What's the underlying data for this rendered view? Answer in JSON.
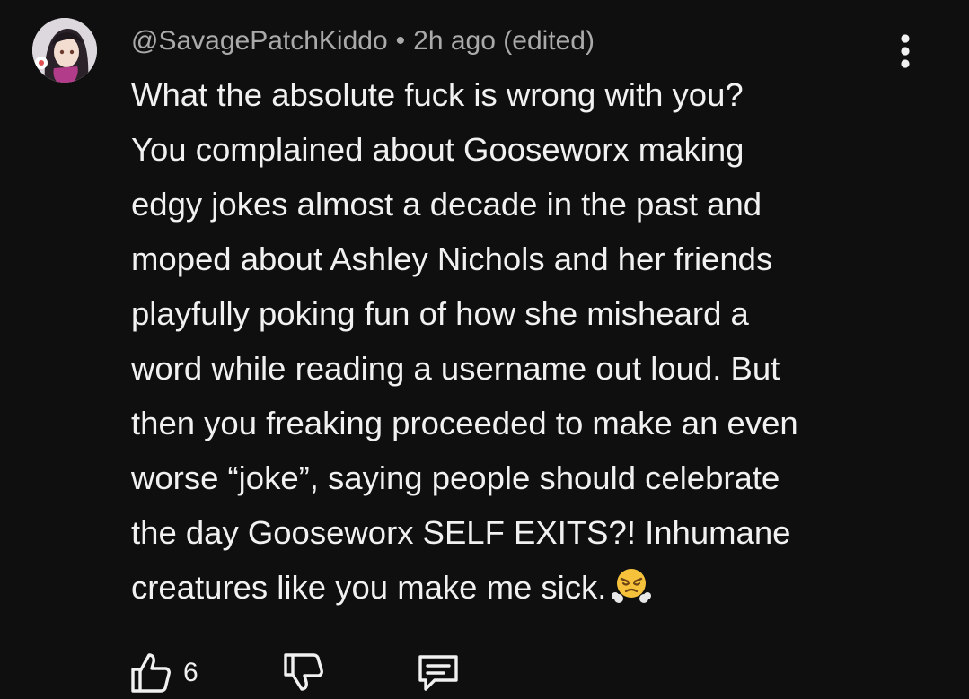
{
  "comment": {
    "author": "@SavagePatchKiddo",
    "separator": "•",
    "time": "2h ago (edited)",
    "lines": [
      "What the absolute fuck is wrong with you?",
      "You complained about Gooseworx making",
      "edgy jokes almost a decade in the past and",
      "moped about Ashley Nichols and her friends",
      "playfully poking fun of how she misheard a",
      "word while reading a username out loud. But",
      "then you freaking proceeded to make an even",
      "worse “joke”, saying people should celebrate",
      "the day Gooseworx SELF EXITS?! Inhumane",
      "creatures like you make me sick."
    ],
    "emoji": "face-with-steam-from-nose"
  },
  "actions": {
    "like_count": "6",
    "like_icon": "thumbs-up-icon",
    "dislike_icon": "thumbs-down-icon",
    "reply_icon": "comment-icon"
  },
  "colors": {
    "background": "#0f0f0f",
    "text": "#f1f1f1",
    "meta_text": "#aaaaaa"
  }
}
